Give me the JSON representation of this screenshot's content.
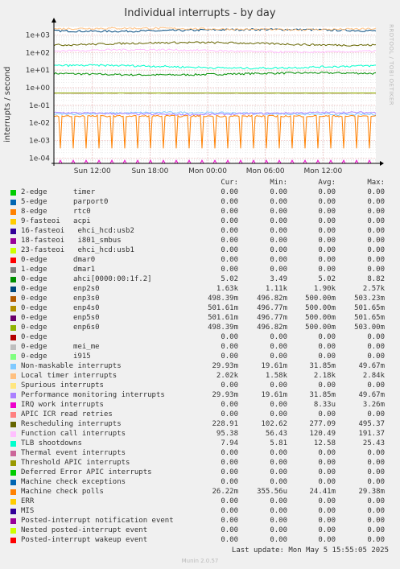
{
  "chart_data": {
    "type": "line",
    "title": "Individual interrupts - by day",
    "ylabel": "interrupts / second",
    "yscale": "log",
    "ylim": [
      5e-05,
      3000
    ],
    "yticks": [
      "1e-04",
      "1e-03",
      "1e-02",
      "1e-01",
      "1e+00",
      "1e+01",
      "1e+02",
      "1e+03"
    ],
    "xticks": [
      "Sun 12:00",
      "Sun 18:00",
      "Mon 00:00",
      "Mon 06:00",
      "Mon 12:00"
    ],
    "grid": true,
    "columns": [
      "Cur:",
      "Min:",
      "Avg:",
      "Max:"
    ],
    "series": [
      {
        "name": "2-edge      timer",
        "color": "#00cc00",
        "values": [
          "0.00",
          "0.00",
          "0.00",
          "0.00"
        ]
      },
      {
        "name": "5-edge      parport0",
        "color": "#0066b3",
        "values": [
          "0.00",
          "0.00",
          "0.00",
          "0.00"
        ]
      },
      {
        "name": "8-edge      rtc0",
        "color": "#ff8000",
        "values": [
          "0.00",
          "0.00",
          "0.00",
          "0.00"
        ]
      },
      {
        "name": "9-fasteoi   acpi",
        "color": "#ffcc00",
        "values": [
          "0.00",
          "0.00",
          "0.00",
          "0.00"
        ]
      },
      {
        "name": "16-fasteoi   ehci_hcd:usb2",
        "color": "#330099",
        "values": [
          "0.00",
          "0.00",
          "0.00",
          "0.00"
        ]
      },
      {
        "name": "18-fasteoi   i801_smbus",
        "color": "#990099",
        "values": [
          "0.00",
          "0.00",
          "0.00",
          "0.00"
        ]
      },
      {
        "name": "23-fasteoi   ehci_hcd:usb1",
        "color": "#ccff00",
        "values": [
          "0.00",
          "0.00",
          "0.00",
          "0.00"
        ]
      },
      {
        "name": "0-edge      dmar0",
        "color": "#ff0000",
        "values": [
          "0.00",
          "0.00",
          "0.00",
          "0.00"
        ]
      },
      {
        "name": "1-edge      dmar1",
        "color": "#808080",
        "values": [
          "0.00",
          "0.00",
          "0.00",
          "0.00"
        ]
      },
      {
        "name": "0-edge      ahci[0000:00:1f.2]",
        "color": "#008f00",
        "values": [
          "5.02",
          "3.49",
          "5.02",
          "8.82"
        ]
      },
      {
        "name": "0-edge      enp2s0",
        "color": "#00487d",
        "values": [
          "1.63k",
          "1.11k",
          "1.90k",
          "2.57k"
        ]
      },
      {
        "name": "0-edge      enp3s0",
        "color": "#b35a00",
        "values": [
          "498.39m",
          "496.82m",
          "500.00m",
          "503.23m"
        ]
      },
      {
        "name": "0-edge      enp4s0",
        "color": "#b38f00",
        "values": [
          "501.61m",
          "496.77m",
          "500.00m",
          "501.65m"
        ]
      },
      {
        "name": "0-edge      enp5s0",
        "color": "#6b006b",
        "values": [
          "501.61m",
          "496.77m",
          "500.00m",
          "501.65m"
        ]
      },
      {
        "name": "0-edge      enp6s0",
        "color": "#8fb300",
        "values": [
          "498.39m",
          "496.82m",
          "500.00m",
          "503.00m"
        ]
      },
      {
        "name": "0-edge",
        "color": "#b30000",
        "values": [
          "0.00",
          "0.00",
          "0.00",
          "0.00"
        ]
      },
      {
        "name": "0-edge      mei_me",
        "color": "#bebebe",
        "values": [
          "0.00",
          "0.00",
          "0.00",
          "0.00"
        ]
      },
      {
        "name": "0-edge      i915",
        "color": "#80ff80",
        "values": [
          "0.00",
          "0.00",
          "0.00",
          "0.00"
        ]
      },
      {
        "name": "Non-maskable interrupts",
        "color": "#80c9ff",
        "values": [
          "29.93m",
          "19.61m",
          "31.85m",
          "49.67m"
        ]
      },
      {
        "name": "Local timer interrupts",
        "color": "#ffc080",
        "values": [
          "2.02k",
          "1.58k",
          "2.18k",
          "2.84k"
        ]
      },
      {
        "name": "Spurious interrupts",
        "color": "#ffe680",
        "values": [
          "0.00",
          "0.00",
          "0.00",
          "0.00"
        ]
      },
      {
        "name": "Performance monitoring interrupts",
        "color": "#aa80ff",
        "values": [
          "29.93m",
          "19.61m",
          "31.85m",
          "49.67m"
        ]
      },
      {
        "name": "IRQ work interrupts",
        "color": "#ee00cc",
        "values": [
          "0.00",
          "0.00",
          "8.33u",
          "3.26m"
        ]
      },
      {
        "name": "APIC ICR read retries",
        "color": "#ff8080",
        "values": [
          "0.00",
          "0.00",
          "0.00",
          "0.00"
        ]
      },
      {
        "name": "Rescheduling interrupts",
        "color": "#666600",
        "values": [
          "228.91",
          "102.62",
          "277.09",
          "495.37"
        ]
      },
      {
        "name": "Function call interrupts",
        "color": "#ffbfff",
        "values": [
          "95.38",
          "56.43",
          "120.49",
          "191.37"
        ]
      },
      {
        "name": "TLB shootdowns",
        "color": "#00ffcc",
        "values": [
          "7.94",
          "5.81",
          "12.58",
          "25.43"
        ]
      },
      {
        "name": "Thermal event interrupts",
        "color": "#cc6699",
        "values": [
          "0.00",
          "0.00",
          "0.00",
          "0.00"
        ]
      },
      {
        "name": "Threshold APIC interrupts",
        "color": "#999900",
        "values": [
          "0.00",
          "0.00",
          "0.00",
          "0.00"
        ]
      },
      {
        "name": "Deferred Error APIC interrupts",
        "color": "#00cc00",
        "values": [
          "0.00",
          "0.00",
          "0.00",
          "0.00"
        ]
      },
      {
        "name": "Machine check exceptions",
        "color": "#0066b3",
        "values": [
          "0.00",
          "0.00",
          "0.00",
          "0.00"
        ]
      },
      {
        "name": "Machine check polls",
        "color": "#ff8000",
        "values": [
          "26.22m",
          "355.56u",
          "24.41m",
          "29.38m"
        ]
      },
      {
        "name": "ERR",
        "color": "#ffcc00",
        "values": [
          "0.00",
          "0.00",
          "0.00",
          "0.00"
        ]
      },
      {
        "name": "MIS",
        "color": "#330099",
        "values": [
          "0.00",
          "0.00",
          "0.00",
          "0.00"
        ]
      },
      {
        "name": "Posted-interrupt notification event",
        "color": "#990099",
        "values": [
          "0.00",
          "0.00",
          "0.00",
          "0.00"
        ]
      },
      {
        "name": "Nested posted-interrupt event",
        "color": "#ccff00",
        "values": [
          "0.00",
          "0.00",
          "0.00",
          "0.00"
        ]
      },
      {
        "name": "Posted-interrupt wakeup event",
        "color": "#ff0000",
        "values": [
          "0.00",
          "0.00",
          "0.00",
          "0.00"
        ]
      }
    ]
  },
  "side_credit": "RRDTOOL / TOBI OETIKER",
  "last_update": "Last update: Mon May  5 15:55:05 2025",
  "footer": "Munin 2.0.57"
}
